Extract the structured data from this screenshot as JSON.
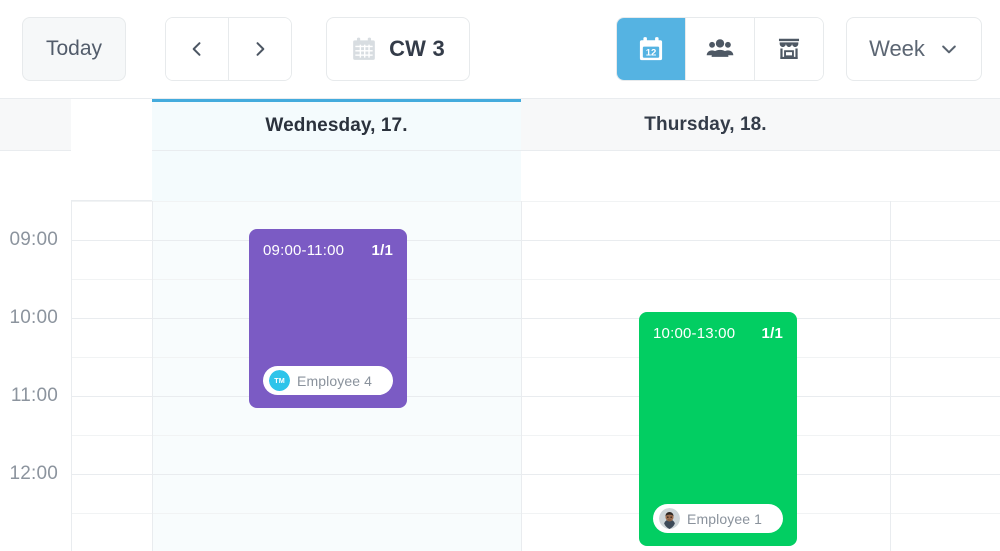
{
  "toolbar": {
    "today_label": "Today",
    "prev_icon": "chevron-left-icon",
    "next_icon": "chevron-right-icon",
    "week_number_label": "CW 3",
    "week_number_icon": "calendar-icon",
    "view_modes": [
      {
        "name": "calendar-view",
        "icon": "calendar-12-icon",
        "active": true
      },
      {
        "name": "team-view",
        "icon": "people-group-icon",
        "active": false
      },
      {
        "name": "store-view",
        "icon": "store-icon",
        "active": false
      }
    ],
    "range_select_label": "Week",
    "range_select_icon": "chevron-down-icon",
    "accent_color": "#55b3e2"
  },
  "calendar": {
    "today_marker_color": "#44abdd",
    "today_column_bg": "#f8fcfd",
    "columns": [
      {
        "label": "Wednesday, 17.",
        "is_today": true
      },
      {
        "label": "Thursday, 18.",
        "is_today": false
      },
      {
        "label": "",
        "is_today": false
      }
    ],
    "time_labels": [
      "09:00",
      "10:00",
      "11:00",
      "12:00"
    ],
    "events": [
      {
        "time": "09:00-11:00",
        "count": "1/1",
        "color": "#7b5bc4",
        "employee": "Employee 4",
        "avatar_type": "initials-avatar",
        "avatar_color": "#2ec4ea"
      },
      {
        "time": "10:00-13:00",
        "count": "1/1",
        "color": "#02ce62",
        "employee": "Employee 1",
        "avatar_type": "photo-avatar",
        "avatar_color": "#8d6a53"
      }
    ]
  }
}
